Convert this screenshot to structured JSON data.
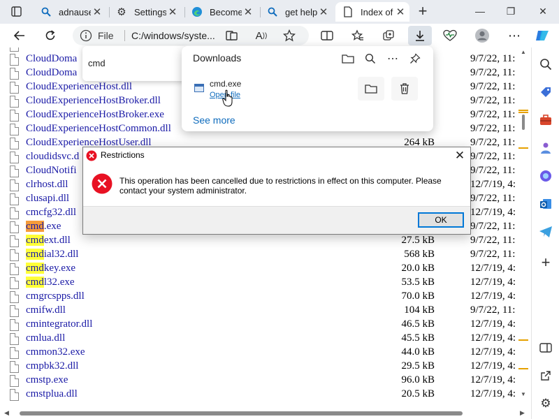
{
  "browser": {
    "tabs": [
      {
        "label": "adnause",
        "icon": "search-icon"
      },
      {
        "label": "Settings",
        "icon": "gear-icon"
      },
      {
        "label": "Become",
        "icon": "edge-icon"
      },
      {
        "label": "get help",
        "icon": "search-icon"
      },
      {
        "label": "Index of",
        "icon": "page-icon",
        "active": true
      }
    ],
    "address": {
      "scheme": "File",
      "url": "C:/windows/syste..."
    }
  },
  "find": {
    "query": "cmd"
  },
  "downloads": {
    "title": "Downloads",
    "item": {
      "filename": "cmd.exe",
      "action": "Open file"
    },
    "see_more": "See more"
  },
  "dialog": {
    "title": "Restrictions",
    "message": "This operation has been cancelled due to restrictions in effect on this computer. Please contact your system administrator.",
    "ok_label": "OK"
  },
  "files": [
    {
      "pre": "",
      "hl": "",
      "name": "CloudDoma",
      "size": "",
      "date": "9/7/22, 11:"
    },
    {
      "pre": "",
      "hl": "",
      "name": "CloudDoma",
      "size": "",
      "date": "9/7/22, 11:"
    },
    {
      "pre": "",
      "hl": "",
      "name": "CloudExperienceHost.dll",
      "size": "",
      "date": "9/7/22, 11:"
    },
    {
      "pre": "",
      "hl": "",
      "name": "CloudExperienceHostBroker.dll",
      "size": "",
      "date": "9/7/22, 11:"
    },
    {
      "pre": "",
      "hl": "",
      "name": "CloudExperienceHostBroker.exe",
      "size": "",
      "date": "9/7/22, 11:"
    },
    {
      "pre": "",
      "hl": "",
      "name": "CloudExperienceHostCommon.dll",
      "size": "",
      "date": "9/7/22, 11:"
    },
    {
      "pre": "",
      "hl": "",
      "name": "CloudExperienceHostUser.dll",
      "size": "264 kB",
      "date": "9/7/22, 11:"
    },
    {
      "pre": "",
      "hl": "",
      "name": "cloudidsvc.d",
      "size": "",
      "date": "9/7/22, 11:"
    },
    {
      "pre": "",
      "hl": "",
      "name": "CloudNotifi",
      "size": "",
      "date": "9/7/22, 11:"
    },
    {
      "pre": "",
      "hl": "",
      "name": "clrhost.dll",
      "size": "",
      "date": "12/7/19, 4:"
    },
    {
      "pre": "",
      "hl": "",
      "name": "clusapi.dll",
      "size": "",
      "date": "9/7/22, 11:"
    },
    {
      "pre": "",
      "hl": "",
      "name": "cmcfg32.dll",
      "size": "",
      "date": "12/7/19, 4:"
    },
    {
      "pre": "",
      "hl": "cmd",
      "cur": true,
      "name": ".exe",
      "size": "",
      "date": "9/7/22, 11:"
    },
    {
      "pre": "",
      "hl": "cmd",
      "name": "ext.dll",
      "size": "27.5 kB",
      "date": "9/7/22, 11:"
    },
    {
      "pre": "",
      "hl": "cmd",
      "name": "ial32.dll",
      "size": "568 kB",
      "date": "9/7/22, 11:"
    },
    {
      "pre": "",
      "hl": "cmd",
      "name": "key.exe",
      "size": "20.0 kB",
      "date": "12/7/19, 4:"
    },
    {
      "pre": "",
      "hl": "cmd",
      "name": "l32.exe",
      "size": "53.5 kB",
      "date": "12/7/19, 4:"
    },
    {
      "pre": "",
      "hl": "",
      "name": "cmgrcspps.dll",
      "size": "70.0 kB",
      "date": "12/7/19, 4:"
    },
    {
      "pre": "",
      "hl": "",
      "name": "cmifw.dll",
      "size": "104 kB",
      "date": "9/7/22, 11:"
    },
    {
      "pre": "",
      "hl": "",
      "name": "cmintegrator.dll",
      "size": "46.5 kB",
      "date": "12/7/19, 4:"
    },
    {
      "pre": "",
      "hl": "",
      "name": "cmlua.dll",
      "size": "45.5 kB",
      "date": "12/7/19, 4:"
    },
    {
      "pre": "",
      "hl": "",
      "name": "cmmon32.exe",
      "size": "44.0 kB",
      "date": "12/7/19, 4:"
    },
    {
      "pre": "",
      "hl": "",
      "name": "cmpbk32.dll",
      "size": "29.5 kB",
      "date": "12/7/19, 4:"
    },
    {
      "pre": "",
      "hl": "",
      "name": "cmstp.exe",
      "size": "96.0 kB",
      "date": "12/7/19, 4:"
    },
    {
      "pre": "",
      "hl": "",
      "name": "cmstplua.dll",
      "size": "20.5 kB",
      "date": "12/7/19, 4:"
    }
  ],
  "colors": {
    "link": "#1a1aa6",
    "highlight": "#ffff38",
    "current_match": "#f59c3a",
    "accent": "#0f6cbd",
    "error": "#e81123"
  }
}
